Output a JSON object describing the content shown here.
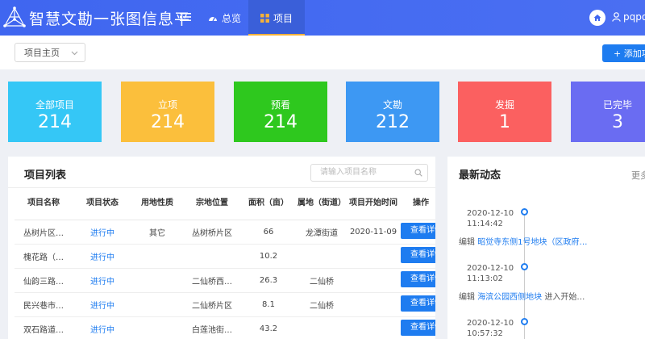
{
  "header": {
    "title": "智慧文勘一张图信息平",
    "nav": [
      {
        "label": "总览",
        "icon": "dashboard-icon"
      },
      {
        "label": "项目",
        "icon": "grid-icon"
      }
    ],
    "user": "pqpo"
  },
  "toolbar": {
    "select_value": "项目主页",
    "add_label": "+ 添加项目"
  },
  "stats": [
    {
      "label": "全部项目",
      "value": "214",
      "color": "#35c7f6"
    },
    {
      "label": "立项",
      "value": "214",
      "color": "#fbbf3c"
    },
    {
      "label": "预看",
      "value": "214",
      "color": "#2ec81e"
    },
    {
      "label": "文勘",
      "value": "212",
      "color": "#3d98f3"
    },
    {
      "label": "发掘",
      "value": "1",
      "color": "#fb6060"
    },
    {
      "label": "已完毕",
      "value": "3",
      "color": "#6a6cf2"
    }
  ],
  "project_list": {
    "title": "项目列表",
    "search_placeholder": "请输入项目名称",
    "columns": [
      "项目名称",
      "项目状态",
      "用地性质",
      "宗地位置",
      "面积（亩）",
      "属地（街道）",
      "项目开始时间",
      "操作"
    ],
    "rows": [
      {
        "name": "丛树片区…",
        "status": "进行中",
        "land_use": "其它",
        "location": "丛树桥片区",
        "area": "66",
        "district": "龙潭街道",
        "start": "2020-11-09",
        "action": "查看详情"
      },
      {
        "name": "槐花路（…",
        "status": "进行中",
        "land_use": "",
        "location": "",
        "area": "10.2",
        "district": "",
        "start": "",
        "action": "查看详情"
      },
      {
        "name": "仙韵三路…",
        "status": "进行中",
        "land_use": "",
        "location": "二仙桥西…",
        "area": "26.3",
        "district": "二仙桥",
        "start": "",
        "action": "查看详情"
      },
      {
        "name": "民兴巷市…",
        "status": "进行中",
        "land_use": "",
        "location": "二仙桥片区",
        "area": "8.1",
        "district": "二仙桥",
        "start": "",
        "action": "查看详情"
      },
      {
        "name": "双石路道…",
        "status": "进行中",
        "land_use": "",
        "location": "白莲池街…",
        "area": "43.2",
        "district": "",
        "start": "",
        "action": "查看详情"
      }
    ]
  },
  "news": {
    "title": "最新动态",
    "more": "更多",
    "items": [
      {
        "date": "2020-12-10",
        "time": "11:14:42",
        "prefix": "编辑",
        "link": "昭觉寺东侧1号地块（区政府…",
        "suffix": ""
      },
      {
        "date": "2020-12-10",
        "time": "11:13:02",
        "prefix": "编辑",
        "link": "海滨公园西侧地块",
        "suffix": "进入开始…"
      },
      {
        "date": "2020-12-10",
        "time": "10:57:32",
        "prefix": "",
        "link": "",
        "suffix": ""
      }
    ]
  }
}
